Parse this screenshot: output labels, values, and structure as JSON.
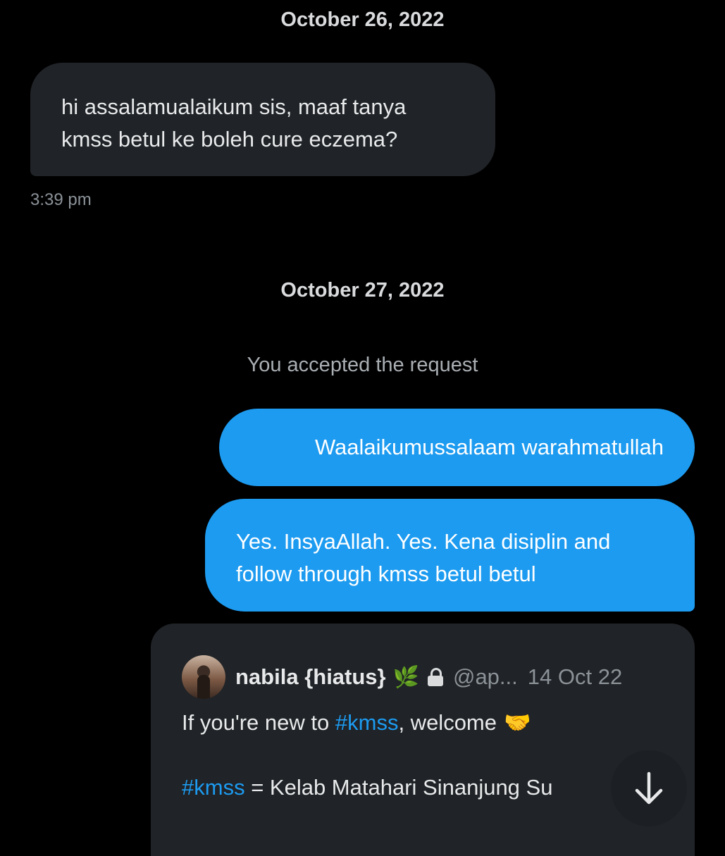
{
  "conversation": {
    "date_1": "October 26, 2022",
    "received_message": {
      "line_1": "hi assalamualaikum sis, maaf tanya",
      "line_2": "kmss betul ke boleh cure eczema?",
      "time": "3:39 pm"
    },
    "date_2": "October 27, 2022",
    "system_note": "You accepted the request",
    "sent_messages": [
      {
        "text": "Waalaikumussalaam warahmatullah"
      },
      {
        "line_1": "Yes. InsyaAllah. Yes. Kena disiplin and",
        "line_2": "follow through kmss betul betul"
      }
    ],
    "quoted_post": {
      "author_name": "nabila {hiatus}",
      "author_emoji": "🌿",
      "handle": "@ap...",
      "date": "14 Oct 22",
      "line_1_prefix": "If you're new to ",
      "line_1_hashtag": "#kmss",
      "line_1_suffix": ", welcome",
      "line_1_emoji": "🤝",
      "line_2_hashtag": "#kmss",
      "line_2_text": " = Kelab Matahari Sinanjung Su"
    }
  },
  "icons": {
    "avatar": "avatar",
    "lock": "lock-icon",
    "scroll_down": "arrow-down-icon"
  },
  "colors": {
    "background": "#000000",
    "received_bubble": "#202327",
    "sent_bubble": "#1d9bf0",
    "hashtag": "#1d9bf0"
  }
}
